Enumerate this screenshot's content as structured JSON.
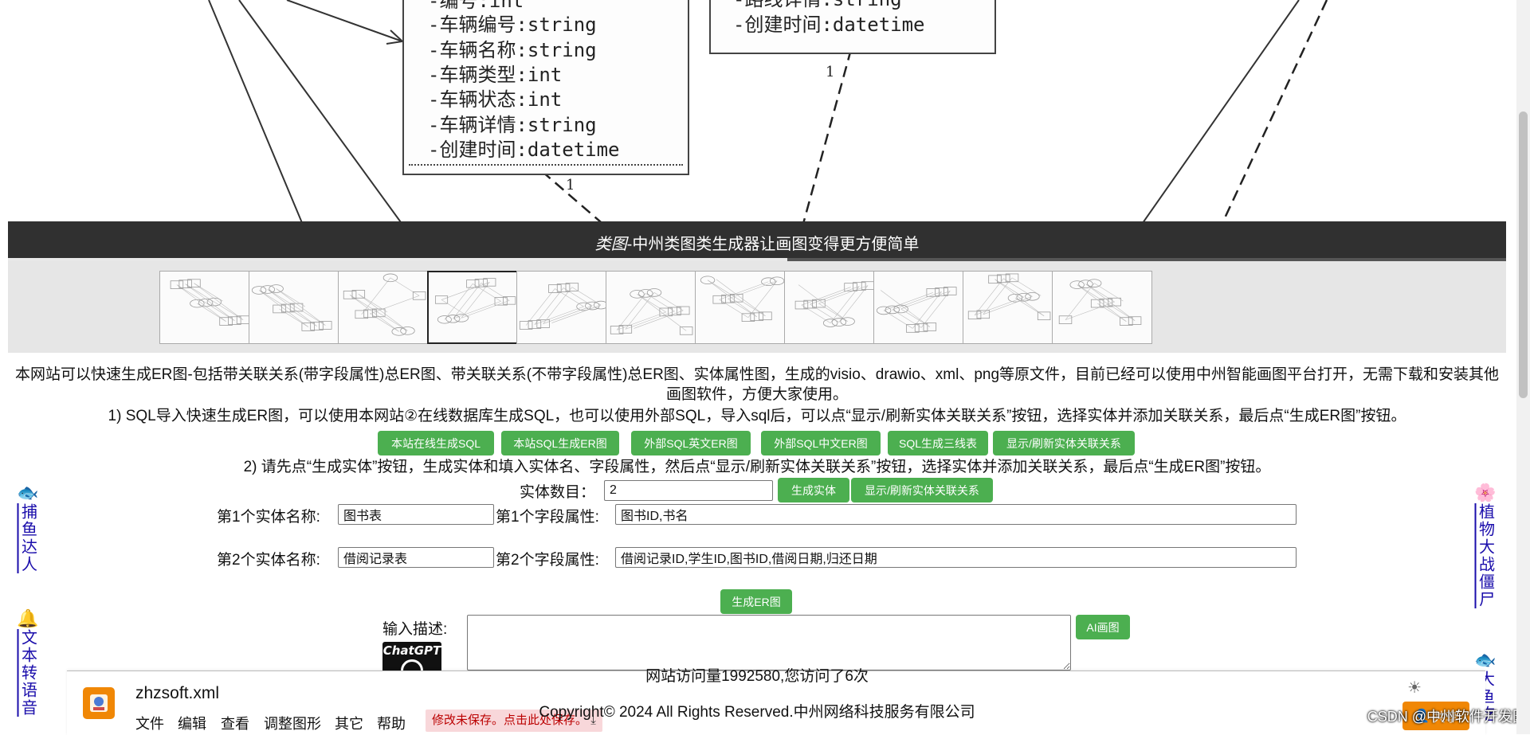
{
  "diagram": {
    "box_left_rows": [
      "-编号:int",
      "-车辆编号:string",
      "-车辆名称:string",
      "-车辆类型:int",
      "-车辆状态:int",
      "-车辆详情:string",
      "-创建时间:datetime"
    ],
    "box_right_rows": [
      "-路线详情:string",
      "-创建时间:datetime"
    ],
    "multiplicity_left": "1",
    "multiplicity_right": "1"
  },
  "banner": {
    "title_italic": "类图",
    "title_rest": "-中州类图类生成器让画图变得更方便简单",
    "progress": 0.52
  },
  "thumbnails": {
    "count": 11,
    "active_index": 3
  },
  "intro": {
    "line1": "本网站可以快速生成ER图-包括带关联关系(带字段属性)总ER图、带关联关系(不带字段属性)总ER图、实体属性图，生成的visio、drawio、xml、png等原文件，目前已经可以使用中州智能画图平台打开，无需下载和安装其他画图软件，方便大家使用。",
    "step1": "1) SQL导入快速生成ER图，可以使用本网站②在线数据库生成SQL，也可以使用外部SQL，导入sql后，可以点“显示/刷新实体关联关系”按钮，选择实体并添加关联关系，最后点“生成ER图”按钮。",
    "step2": "2) 请先点“生成实体”按钮，生成实体和填入实体名、字段属性，然后点“显示/刷新实体关联关系”按钮，选择实体并添加关联关系，最后点“生成ER图”按钮。"
  },
  "buttons_row1": [
    "本站在线生成SQL",
    "本站SQL生成ER图",
    "外部SQL英文ER图",
    "外部SQL中文ER图",
    "SQL生成三线表",
    "显示/刷新实体关联关系"
  ],
  "entity_count": {
    "label": "实体数目：",
    "value": "2"
  },
  "buttons_row2": {
    "generate_entity": "生成实体",
    "refresh_relations": "显示/刷新实体关联关系"
  },
  "entities": [
    {
      "name_label": "第1个实体名称:",
      "name_value": "图书表",
      "attr_label": "第1个字段属性:",
      "attr_value": "图书ID,书名"
    },
    {
      "name_label": "第2个实体名称:",
      "name_value": "借阅记录表",
      "attr_label": "第2个字段属性:",
      "attr_value": "借阅记录ID,学生ID,图书ID,借阅日期,归还日期"
    }
  ],
  "generate_er": "生成ER图",
  "describe": {
    "label": "输入描述:",
    "ai_button": "AI画图",
    "chatgpt_logo": "ChatGPT"
  },
  "side_left": [
    {
      "icon": "fish-icon",
      "glyph": "🐟",
      "text": "捕鱼达人"
    },
    {
      "icon": "bell-icon",
      "glyph": "🔔",
      "text": "文本转语音"
    }
  ],
  "side_right": [
    {
      "icon": "flower-icon",
      "glyph": "🌸",
      "text": "植物大战僵尸"
    },
    {
      "icon": "fish-icon",
      "glyph": "🐟",
      "text": "大鱼吃"
    }
  ],
  "bottom_bar": {
    "file_name": "zhzsoft.xml",
    "menu": [
      "文件",
      "编辑",
      "查看",
      "调整图形",
      "其它",
      "帮助"
    ],
    "unsaved_notice": "修改未保存。点击此处保存。",
    "share_label": "共享"
  },
  "footer": {
    "visits": "网站访问量1992580,您访问了6次",
    "copyright": "Copyright© 2024 All Rights Reserved.中州网络科技服务有限公司",
    "watermark": "CSDN @中州软件开发园"
  }
}
